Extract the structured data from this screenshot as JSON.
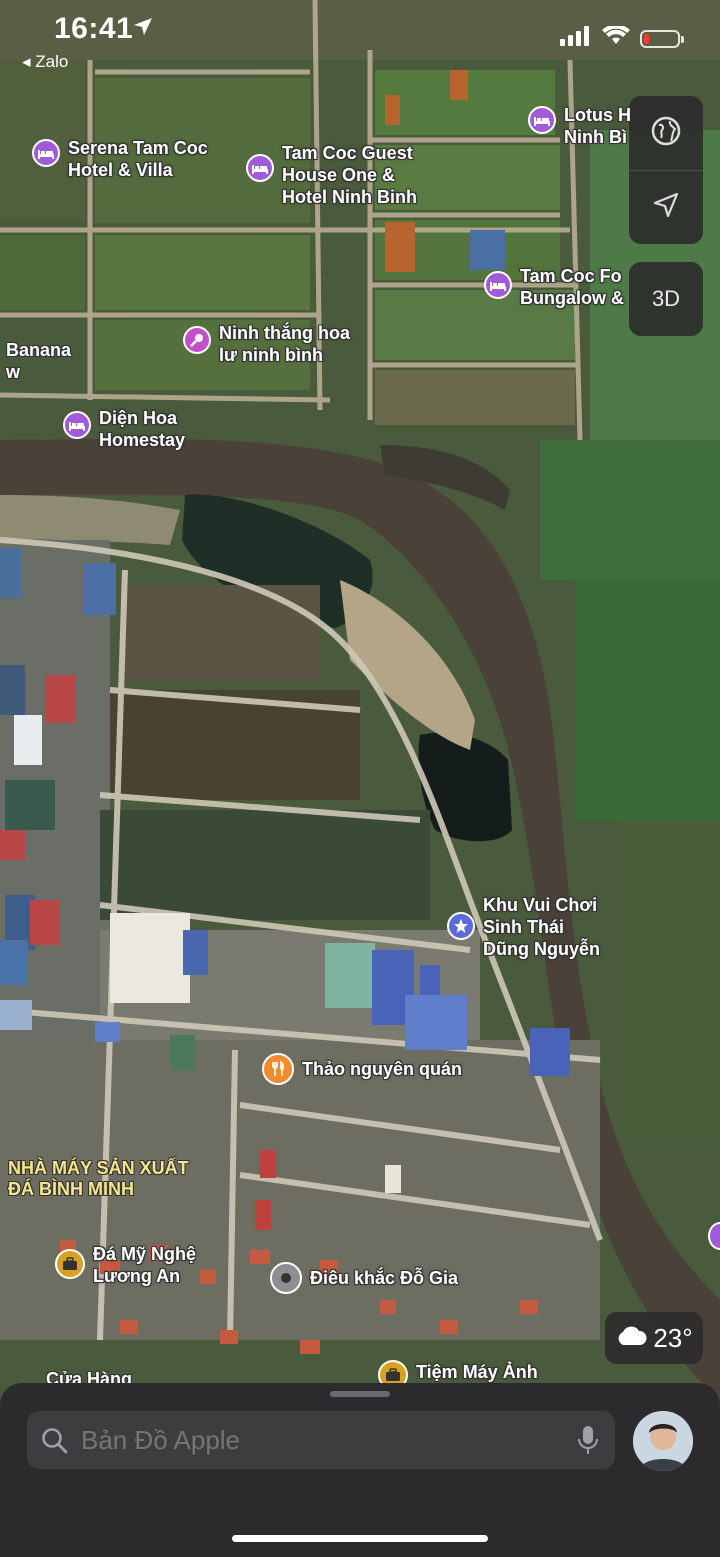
{
  "status_bar": {
    "time": "16:41",
    "back_app": "◂ Zalo",
    "icons": [
      "location-arrow-icon",
      "signal-icon",
      "wifi-icon",
      "battery-low-icon"
    ]
  },
  "controls": {
    "globe_icon": "globe-icon",
    "locate_icon": "location-arrow-icon",
    "three_d_label": "3D"
  },
  "pois": {
    "lotus": {
      "line1": "Lotus H",
      "line2": "Ninh Bì",
      "icon": "bed-icon",
      "color": "#a25bd8"
    },
    "serena": {
      "line1": "Serena Tam Coc",
      "line2": "Hotel & Villa",
      "icon": "bed-icon",
      "color": "#a25bd8"
    },
    "tamcoc_guest": {
      "line1": "Tam Coc Guest",
      "line2": "House One &",
      "line3": "Hotel Ninh Binh",
      "icon": "bed-icon",
      "color": "#a25bd8"
    },
    "tamcoc_fo": {
      "line1": "Tam Coc Fo",
      "line2": "Bungalow &",
      "icon": "bed-icon",
      "color": "#a25bd8"
    },
    "banana": {
      "line1": "Banana",
      "line2": "w"
    },
    "ninh_thang": {
      "line1": "Ninh thắng hoa",
      "line2": "lư ninh bình",
      "icon": "microphone-icon",
      "color": "#c151c9"
    },
    "dien_hoa": {
      "line1": "Diện Hoa",
      "line2": "Homestay",
      "icon": "bed-icon",
      "color": "#a25bd8"
    },
    "khu_vui_choi": {
      "line1": "Khu Vui Chơi",
      "line2": "Sinh Thái",
      "line3": "Dũng Nguyễn",
      "icon": "star-icon",
      "color": "#5a6cd6"
    },
    "thao_nguyen": {
      "line1": "Thảo nguyên quán",
      "icon": "fork-knife-icon",
      "color": "#f28a2e"
    },
    "nha_may": {
      "line1": "NHÀ MÁY SẢN XUẤT",
      "line2": "ĐÁ BÌNH MINH"
    },
    "da_my_nghe": {
      "line1": "Đá Mỹ Nghệ",
      "line2": "Lương An",
      "icon": "briefcase-icon",
      "color": "#d9a21e"
    },
    "dieu_khac": {
      "line1": "Điêu khắc Đỗ Gia",
      "icon": "circle-dot-icon",
      "color": "#8e8e93"
    },
    "cua_hang": {
      "line1": "Cửa Hàng"
    },
    "tiem_may_anh": {
      "line1": "Tiệm Máy Ảnh",
      "icon": "briefcase-icon",
      "color": "#d9a21e"
    }
  },
  "weather": {
    "temperature": "23°",
    "icon": "cloud-icon"
  },
  "search": {
    "placeholder": "Bản Đồ Apple",
    "icon": "search-icon",
    "mic_icon": "microphone-icon"
  },
  "profile": {
    "icon": "avatar"
  }
}
